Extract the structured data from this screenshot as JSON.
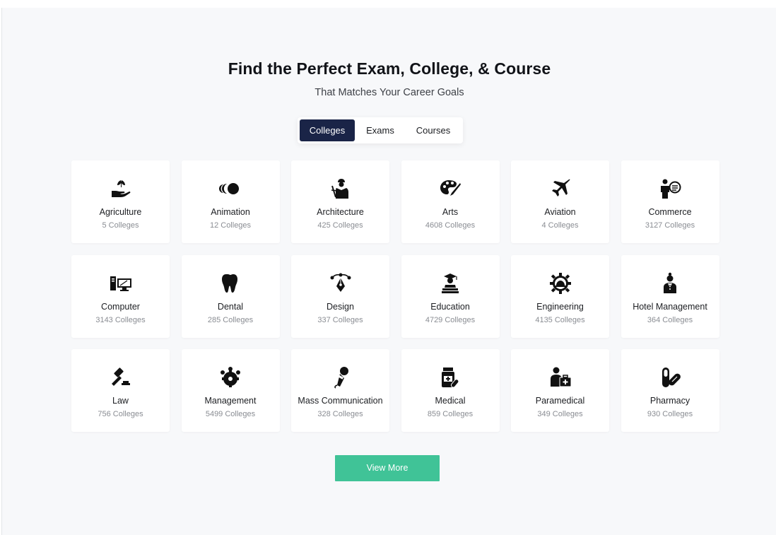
{
  "header": {
    "title": "Find the Perfect Exam, College, & Course",
    "subtitle": "That Matches Your Career Goals"
  },
  "tabs": [
    {
      "label": "Colleges",
      "active": true
    },
    {
      "label": "Exams",
      "active": false
    },
    {
      "label": "Courses",
      "active": false
    }
  ],
  "categories": [
    {
      "name": "Agriculture",
      "count": "5 Colleges",
      "icon": "plant-hand-icon"
    },
    {
      "name": "Animation",
      "count": "12 Colleges",
      "icon": "animation-circles-icon"
    },
    {
      "name": "Architecture",
      "count": "425 Colleges",
      "icon": "architect-icon"
    },
    {
      "name": "Arts",
      "count": "4608 Colleges",
      "icon": "palette-brush-icon"
    },
    {
      "name": "Aviation",
      "count": "4 Colleges",
      "icon": "airplane-icon"
    },
    {
      "name": "Commerce",
      "count": "3127 Colleges",
      "icon": "businessman-icon"
    },
    {
      "name": "Computer",
      "count": "3143 Colleges",
      "icon": "desktop-computer-icon"
    },
    {
      "name": "Dental",
      "count": "285 Colleges",
      "icon": "tooth-icon"
    },
    {
      "name": "Design",
      "count": "337 Colleges",
      "icon": "pen-tool-icon"
    },
    {
      "name": "Education",
      "count": "4729 Colleges",
      "icon": "graduate-books-icon"
    },
    {
      "name": "Engineering",
      "count": "4135 Colleges",
      "icon": "gear-helmet-icon"
    },
    {
      "name": "Hotel Management",
      "count": "364 Colleges",
      "icon": "receptionist-icon"
    },
    {
      "name": "Law",
      "count": "756 Colleges",
      "icon": "gavel-icon"
    },
    {
      "name": "Management",
      "count": "5499 Colleges",
      "icon": "team-gear-icon"
    },
    {
      "name": "Mass Communication",
      "count": "328 Colleges",
      "icon": "microphone-icon"
    },
    {
      "name": "Medical",
      "count": "859 Colleges",
      "icon": "medicine-bottle-icon"
    },
    {
      "name": "Paramedical",
      "count": "349 Colleges",
      "icon": "paramedic-kit-icon"
    },
    {
      "name": "Pharmacy",
      "count": "930 Colleges",
      "icon": "pills-icon"
    }
  ],
  "view_more_label": "View More",
  "colors": {
    "accent": "#40c397",
    "tab_active": "#1a2447",
    "background": "#f7f8fa"
  }
}
